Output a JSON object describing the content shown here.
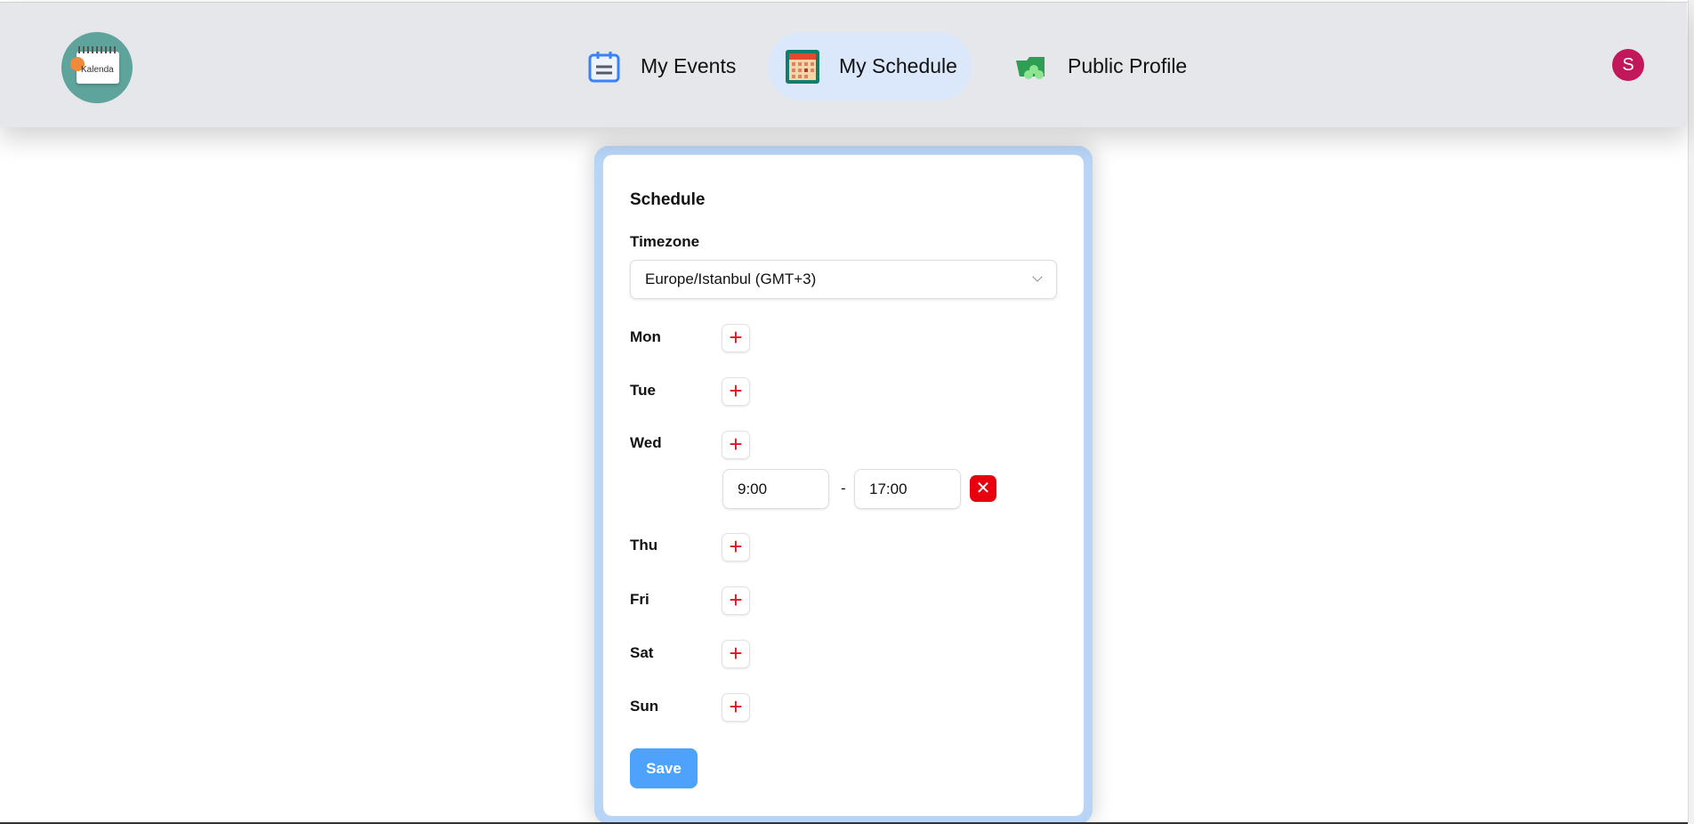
{
  "header": {
    "logo_text": "Kalenda",
    "nav": [
      {
        "label": "My Events",
        "icon": "calendar-list-icon"
      },
      {
        "label": "My Schedule",
        "icon": "calendar-grid-icon",
        "active": true
      },
      {
        "label": "Public Profile",
        "icon": "folder-people-icon"
      }
    ],
    "avatar_initial": "S"
  },
  "schedule": {
    "title": "Schedule",
    "timezone_label": "Timezone",
    "timezone_value": "Europe/Istanbul (GMT+3)",
    "days": [
      "Mon",
      "Tue",
      "Wed",
      "Thu",
      "Fri",
      "Sat",
      "Sun"
    ],
    "add_symbol": "+",
    "wed_slot": {
      "start": "9:00",
      "separator": "-",
      "end": "17:00",
      "remove_symbol": "✕"
    },
    "save_label": "Save"
  },
  "colors": {
    "accent": "#4da3fb",
    "danger": "#e8000f",
    "active_nav": "#dbe8fb"
  }
}
